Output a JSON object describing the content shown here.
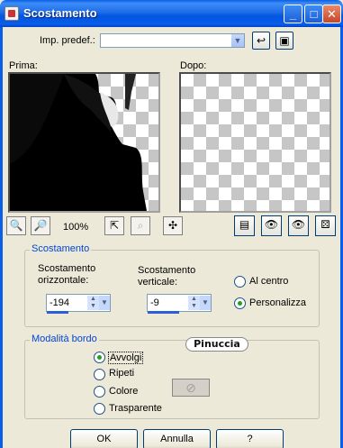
{
  "window": {
    "title": "Scostamento"
  },
  "preset": {
    "label": "Imp. predef.:",
    "value": ""
  },
  "preview": {
    "before_label": "Prima:",
    "after_label": "Dopo:",
    "zoom": "100%"
  },
  "offset_group": {
    "title": "Scostamento",
    "horizontal_label_1": "Scostamento",
    "horizontal_label_2": "orizzontale:",
    "horizontal_value": "-194",
    "vertical_label_1": "Scostamento",
    "vertical_label_2": "verticale:",
    "vertical_value": "-9",
    "center_label": "Al centro",
    "custom_label": "Personalizza",
    "selected": "Personalizza"
  },
  "edge_group": {
    "title": "Modalità bordo",
    "options": [
      "Avvolgi",
      "Ripeti",
      "Colore",
      "Trasparente"
    ],
    "selected": "Avvolgi",
    "watermark": "Pinuccia"
  },
  "buttons": {
    "ok": "OK",
    "cancel": "Annulla",
    "help": "?"
  }
}
